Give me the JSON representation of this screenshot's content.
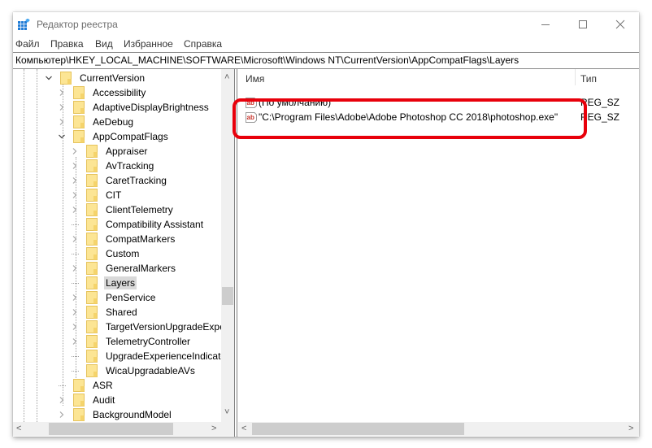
{
  "window": {
    "title": "Редактор реестра",
    "icons": {
      "app": "registry-editor-icon",
      "minimize": "minimize-icon",
      "maximize": "maximize-icon",
      "close": "close-icon"
    }
  },
  "menu": [
    "Файл",
    "Правка",
    "Вид",
    "Избранное",
    "Справка"
  ],
  "address": "Компьютер\\HKEY_LOCAL_MACHINE\\SOFTWARE\\Microsoft\\Windows NT\\CurrentVersion\\AppCompatFlags\\Layers",
  "tree": [
    {
      "label": "CurrentVersion",
      "expander": "expanded"
    },
    {
      "label": "Accessibility",
      "expander": "collapsed"
    },
    {
      "label": "AdaptiveDisplayBrightness",
      "expander": "collapsed"
    },
    {
      "label": "AeDebug",
      "expander": "collapsed"
    },
    {
      "label": "AppCompatFlags",
      "expander": "expanded"
    },
    {
      "label": "Appraiser",
      "expander": "collapsed"
    },
    {
      "label": "AvTracking",
      "expander": "collapsed"
    },
    {
      "label": "CaretTracking",
      "expander": "collapsed"
    },
    {
      "label": "CIT",
      "expander": "collapsed"
    },
    {
      "label": "ClientTelemetry",
      "expander": "collapsed"
    },
    {
      "label": "Compatibility Assistant",
      "expander": "none"
    },
    {
      "label": "CompatMarkers",
      "expander": "collapsed"
    },
    {
      "label": "Custom",
      "expander": "none"
    },
    {
      "label": "GeneralMarkers",
      "expander": "collapsed"
    },
    {
      "label": "Layers",
      "expander": "none",
      "selected": true
    },
    {
      "label": "PenService",
      "expander": "collapsed"
    },
    {
      "label": "Shared",
      "expander": "collapsed"
    },
    {
      "label": "TargetVersionUpgradeExperie",
      "expander": "collapsed"
    },
    {
      "label": "TelemetryController",
      "expander": "collapsed"
    },
    {
      "label": "UpgradeExperienceIndicators",
      "expander": "none"
    },
    {
      "label": "WicaUpgradableAVs",
      "expander": "none"
    },
    {
      "label": "ASR",
      "expander": "none"
    },
    {
      "label": "Audit",
      "expander": "collapsed"
    },
    {
      "label": "BackgroundModel",
      "expander": "collapsed"
    }
  ],
  "values": {
    "columns": {
      "name": "Имя",
      "type": "Тип"
    },
    "rows": [
      {
        "name": "(По умолчанию)",
        "type": "REG_SZ",
        "icon": "string-value-icon"
      },
      {
        "name": "\"C:\\Program Files\\Adobe\\Adobe Photoshop CC 2018\\photoshop.exe\"",
        "type": "REG_SZ",
        "icon": "string-value-icon",
        "highlighted": true
      }
    ]
  },
  "annotation": {
    "color": "#e8000b"
  }
}
